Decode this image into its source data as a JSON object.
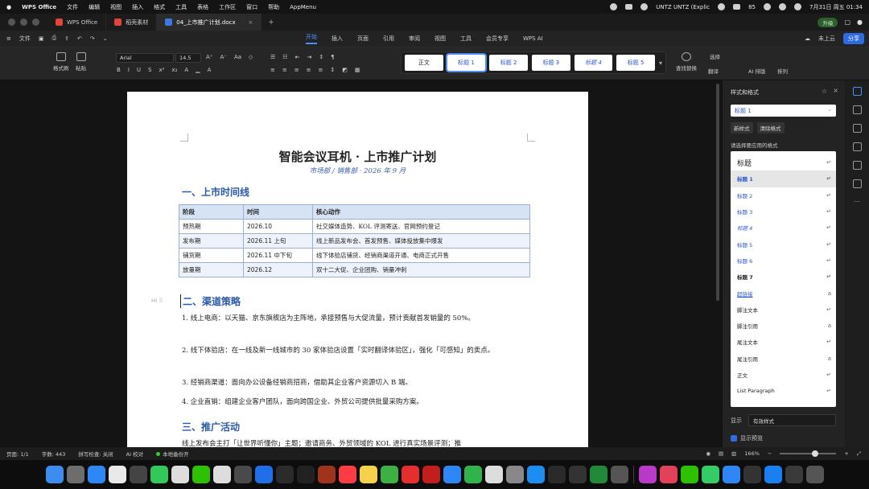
{
  "menubar": {
    "app_name": "WPS Office",
    "items": [
      "文件",
      "编辑",
      "视图",
      "插入",
      "格式",
      "工具",
      "表格",
      "工作区",
      "窗口",
      "帮助",
      "AppMenu"
    ],
    "now_playing": "UNTZ UNTZ (Explic",
    "battery": "85",
    "datetime": "7月31日 周五 01:34"
  },
  "tabbar": {
    "tabs": [
      {
        "label": "WPS Office",
        "color": "#e0443a"
      },
      {
        "label": "稻壳素材",
        "color": "#e0443a"
      },
      {
        "label": "04_上市推广计划.docx",
        "color": "#3c78e0"
      }
    ],
    "plus": "+",
    "upgrade": "升级"
  },
  "ribbon": {
    "file": "文件",
    "tabs": [
      "开始",
      "插入",
      "页面",
      "引用",
      "审阅",
      "视图",
      "工具",
      "会员专享",
      "WPS AI"
    ],
    "active_tab": "开始",
    "cloud": "未上云",
    "share": "分享"
  },
  "toolbar": {
    "format_painter": "格式刷",
    "paste": "粘贴",
    "font": "Arial",
    "font_size": "14.5",
    "styles": [
      "正文",
      "标题 1",
      "标题 2",
      "标题 3",
      "标题 4",
      "标题 5"
    ],
    "find_replace": "查找替换",
    "select": "选择",
    "translate": "翻译",
    "ai_layout": "AI 排版",
    "arrange": "排列"
  },
  "document": {
    "title": "智能会议耳机 · 上市推广计划",
    "subtitle": "市场部 / 销售部 · 2026 年 9 月",
    "section1": "一、上市时间线",
    "table_headers": [
      "阶段",
      "时间",
      "核心动作"
    ],
    "table_rows": [
      [
        "预热期",
        "2026.10",
        "社交媒体造势、KOL 评测寄送、官网预约登记"
      ],
      [
        "发布期",
        "2026.11 上旬",
        "线上新品发布会、首发预售、媒体投放集中爆发"
      ],
      [
        "铺货期",
        "2026.11 中下旬",
        "线下体验店铺货、经销商渠道开通、电商正式开售"
      ],
      [
        "放量期",
        "2026.12",
        "双十二大促、企业团购、销量冲刺"
      ]
    ],
    "hi_mark": "Hi",
    "section2": "二、渠道策略",
    "paragraphs": [
      "1. 线上电商：以天猫、京东旗舰店为主阵地，承接预售与大促流量，预计贡献首发销量的 50%。",
      "2. 线下体验店：在一线及新一线城市的 30 家体验店设置「实时翻译体验区」，强化「可感知」的卖点。",
      "3. 经销商渠道：面向办公设备经销商招商，借助其企业客户资源切入 B 端。",
      "4. 企业直销：组建企业客户团队，面向跨国企业、外贸公司提供批量采购方案。"
    ],
    "section3": "三、推广活动",
    "trailing": "线上发布会主打「让世界听懂你」主题；邀请商务、外贸领域的 KOL 进行真实场景评测；推"
  },
  "style_pane": {
    "title": "样式和格式",
    "current": "标题 1",
    "new_style": "新样式",
    "clear_format": "清除格式",
    "hint": "请选择要应用的格式",
    "styles": [
      "标题",
      "标题 1",
      "标题 2",
      "标题 3",
      "标题 4",
      "标题 5",
      "标题 6",
      "标题 7",
      "超链接",
      "脚注文本",
      "脚注引用",
      "尾注文本",
      "尾注引用",
      "正文",
      "List Paragraph"
    ],
    "show_label": "显示",
    "show_value": "有效样式",
    "preview": "显示预览"
  },
  "statusbar": {
    "page": "页面: 1/1",
    "words": "字数: 443",
    "spellcheck": "拼写检查: 关闭",
    "ai_check": "AI 校对",
    "backup": "本地备份开",
    "zoom": "166%",
    "zoom_fraction": 0.63
  }
}
